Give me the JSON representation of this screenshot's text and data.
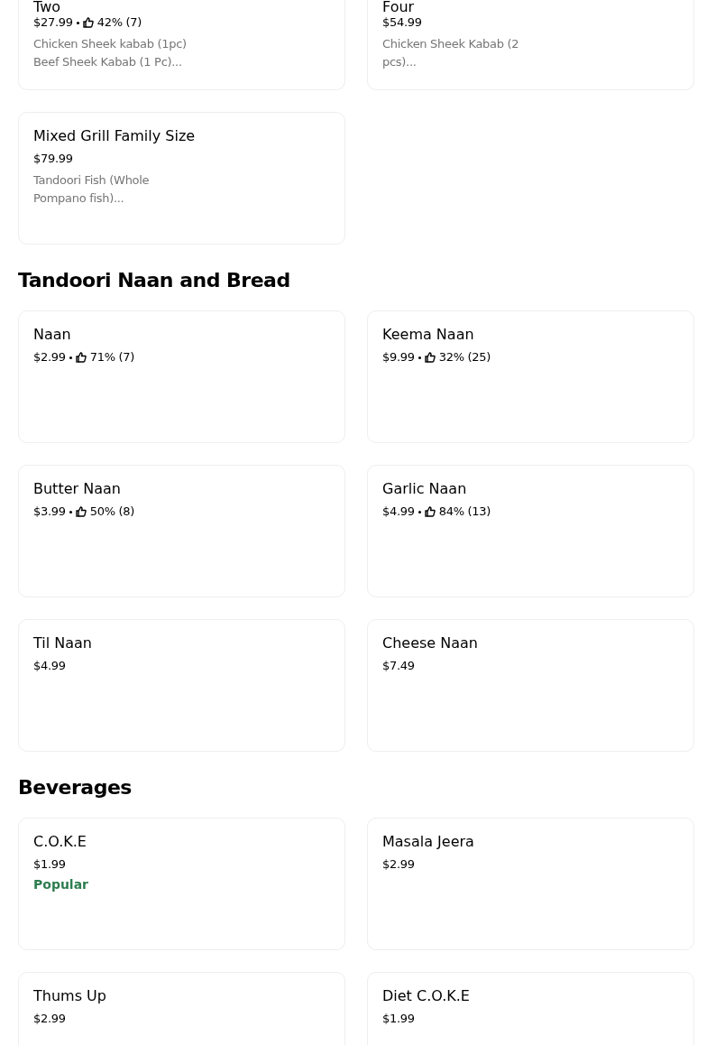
{
  "sections": [
    {
      "items": [
        {
          "name": "Two",
          "price": "$27.99",
          "rating": "42% (7)",
          "description": "Chicken Sheek kabab (1pc) Beef Sheek Kabab (1 Pc)..."
        },
        {
          "name": "Four",
          "price": "$54.99",
          "description": "Chicken Sheek Kabab (2 pcs)..."
        },
        {
          "name": "Mixed Grill Family Size",
          "price": "$79.99",
          "description": "Tandoori Fish (Whole Pompano fish)..."
        }
      ]
    },
    {
      "title": "Tandoori Naan and Bread",
      "items": [
        {
          "name": "Naan",
          "price": "$2.99",
          "rating": "71% (7)"
        },
        {
          "name": "Keema Naan",
          "price": "$9.99",
          "rating": "32% (25)"
        },
        {
          "name": "Butter Naan",
          "price": "$3.99",
          "rating": "50% (8)"
        },
        {
          "name": "Garlic Naan",
          "price": "$4.99",
          "rating": "84% (13)"
        },
        {
          "name": "Til Naan",
          "price": "$4.99"
        },
        {
          "name": "Cheese Naan",
          "price": "$7.49"
        }
      ]
    },
    {
      "title": "Beverages",
      "items": [
        {
          "name": "C.O.K.E",
          "price": "$1.99",
          "badge": "Popular"
        },
        {
          "name": "Masala Jeera",
          "price": "$2.99"
        },
        {
          "name": "Thums Up",
          "price": "$2.99"
        },
        {
          "name": "Diet C.O.K.E",
          "price": "$1.99"
        }
      ]
    }
  ]
}
